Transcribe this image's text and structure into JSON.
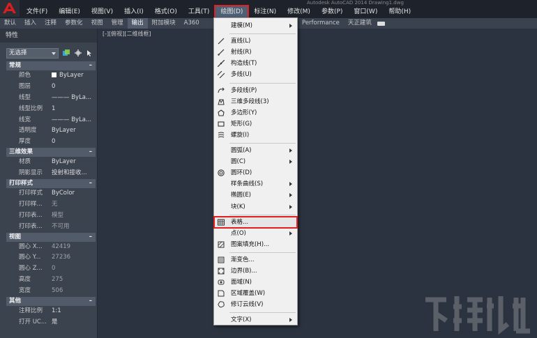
{
  "window": {
    "title_fragment": "Autodesk AutoCAD 2014   Drawing1.dwg"
  },
  "menubar": [
    {
      "label": "文件(F)"
    },
    {
      "label": "编辑(E)"
    },
    {
      "label": "视图(V)"
    },
    {
      "label": "插入(I)"
    },
    {
      "label": "格式(O)"
    },
    {
      "label": "工具(T)"
    },
    {
      "label": "绘图(D)"
    },
    {
      "label": "标注(N)"
    },
    {
      "label": "修改(M)"
    },
    {
      "label": "参数(P)"
    },
    {
      "label": "窗口(W)"
    },
    {
      "label": "帮助(H)"
    }
  ],
  "ribbon": {
    "tabs": [
      {
        "label": "默认"
      },
      {
        "label": "插入"
      },
      {
        "label": "注释"
      },
      {
        "label": "参数化"
      },
      {
        "label": "视图"
      },
      {
        "label": "管理"
      },
      {
        "label": "输出"
      },
      {
        "label": "附加模块"
      },
      {
        "label": "A360"
      }
    ],
    "right_tabs": [
      {
        "label": "Performance"
      },
      {
        "label": "天正建筑"
      }
    ]
  },
  "palette": {
    "title": "特性",
    "selection": "无选择",
    "sections": [
      {
        "title": "常规",
        "rows": [
          {
            "name": "颜色",
            "value": "ByLayer"
          },
          {
            "name": "图层",
            "value": "0"
          },
          {
            "name": "线型",
            "value": "——— ByLa..."
          },
          {
            "name": "线型比例",
            "value": "1"
          },
          {
            "name": "线宽",
            "value": "——— ByLa..."
          },
          {
            "name": "透明度",
            "value": "ByLayer"
          },
          {
            "name": "厚度",
            "value": "0"
          }
        ]
      },
      {
        "title": "三维效果",
        "rows": [
          {
            "name": "材质",
            "value": "ByLayer"
          },
          {
            "name": "阴影显示",
            "value": "投射和接收..."
          }
        ]
      },
      {
        "title": "打印样式",
        "rows": [
          {
            "name": "打印样式",
            "value": "ByColor"
          },
          {
            "name": "打印样...",
            "value": "无"
          },
          {
            "name": "打印表...",
            "value": "模型"
          },
          {
            "name": "打印表...",
            "value": "不可用"
          }
        ]
      },
      {
        "title": "视图",
        "rows": [
          {
            "name": "圆心 X...",
            "value": "42419"
          },
          {
            "name": "圆心 Y...",
            "value": "27236"
          },
          {
            "name": "圆心 Z...",
            "value": "0"
          },
          {
            "name": "高度",
            "value": "275"
          },
          {
            "name": "宽度",
            "value": "506"
          }
        ]
      },
      {
        "title": "其他",
        "rows": [
          {
            "name": "注释比例",
            "value": "1:1"
          },
          {
            "name": "打开 UC...",
            "value": "是"
          }
        ]
      }
    ]
  },
  "viewport": {
    "label": "[-][俯视][二维线框]"
  },
  "draw_menu": [
    {
      "label": "建模(M)",
      "icon": "none",
      "submenu": true
    },
    {
      "separator": true
    },
    {
      "label": "直线(L)",
      "icon": "line-icon"
    },
    {
      "label": "射线(R)",
      "icon": "ray-icon"
    },
    {
      "label": "构造线(T)",
      "icon": "xline-icon"
    },
    {
      "label": "多线(U)",
      "icon": "mline-icon"
    },
    {
      "separator": true
    },
    {
      "label": "多段线(P)",
      "icon": "polyline-icon"
    },
    {
      "label": "三维多段线(3)",
      "icon": "3dpoly-icon"
    },
    {
      "label": "多边形(Y)",
      "icon": "polygon-icon"
    },
    {
      "label": "矩形(G)",
      "icon": "rectangle-icon"
    },
    {
      "label": "螺旋(I)",
      "icon": "helix-icon"
    },
    {
      "separator": true
    },
    {
      "label": "圆弧(A)",
      "icon": "none",
      "submenu": true
    },
    {
      "label": "圆(C)",
      "icon": "none",
      "submenu": true
    },
    {
      "label": "圆环(D)",
      "icon": "donut-icon"
    },
    {
      "label": "样条曲线(S)",
      "icon": "none",
      "submenu": true
    },
    {
      "label": "椭圆(E)",
      "icon": "none",
      "submenu": true
    },
    {
      "label": "块(K)",
      "icon": "none",
      "submenu": true
    },
    {
      "separator": true
    },
    {
      "label": "表格...",
      "icon": "table-icon",
      "highlight": true
    },
    {
      "label": "点(O)",
      "icon": "none",
      "submenu": true
    },
    {
      "label": "图案填充(H)...",
      "icon": "hatch-icon"
    },
    {
      "separator": true
    },
    {
      "label": "渐变色...",
      "icon": "gradient-icon"
    },
    {
      "label": "边界(B)...",
      "icon": "boundary-icon"
    },
    {
      "label": "面域(N)",
      "icon": "region-icon"
    },
    {
      "label": "区域覆盖(W)",
      "icon": "wipeout-icon"
    },
    {
      "label": "修订云线(V)",
      "icon": "revcloud-icon"
    },
    {
      "separator": true
    },
    {
      "label": "文字(X)",
      "icon": "none",
      "submenu": true
    }
  ],
  "colors": {
    "highlight": "#e02020",
    "background": "#2b3340",
    "menu_bg": "#f0f0f0"
  }
}
